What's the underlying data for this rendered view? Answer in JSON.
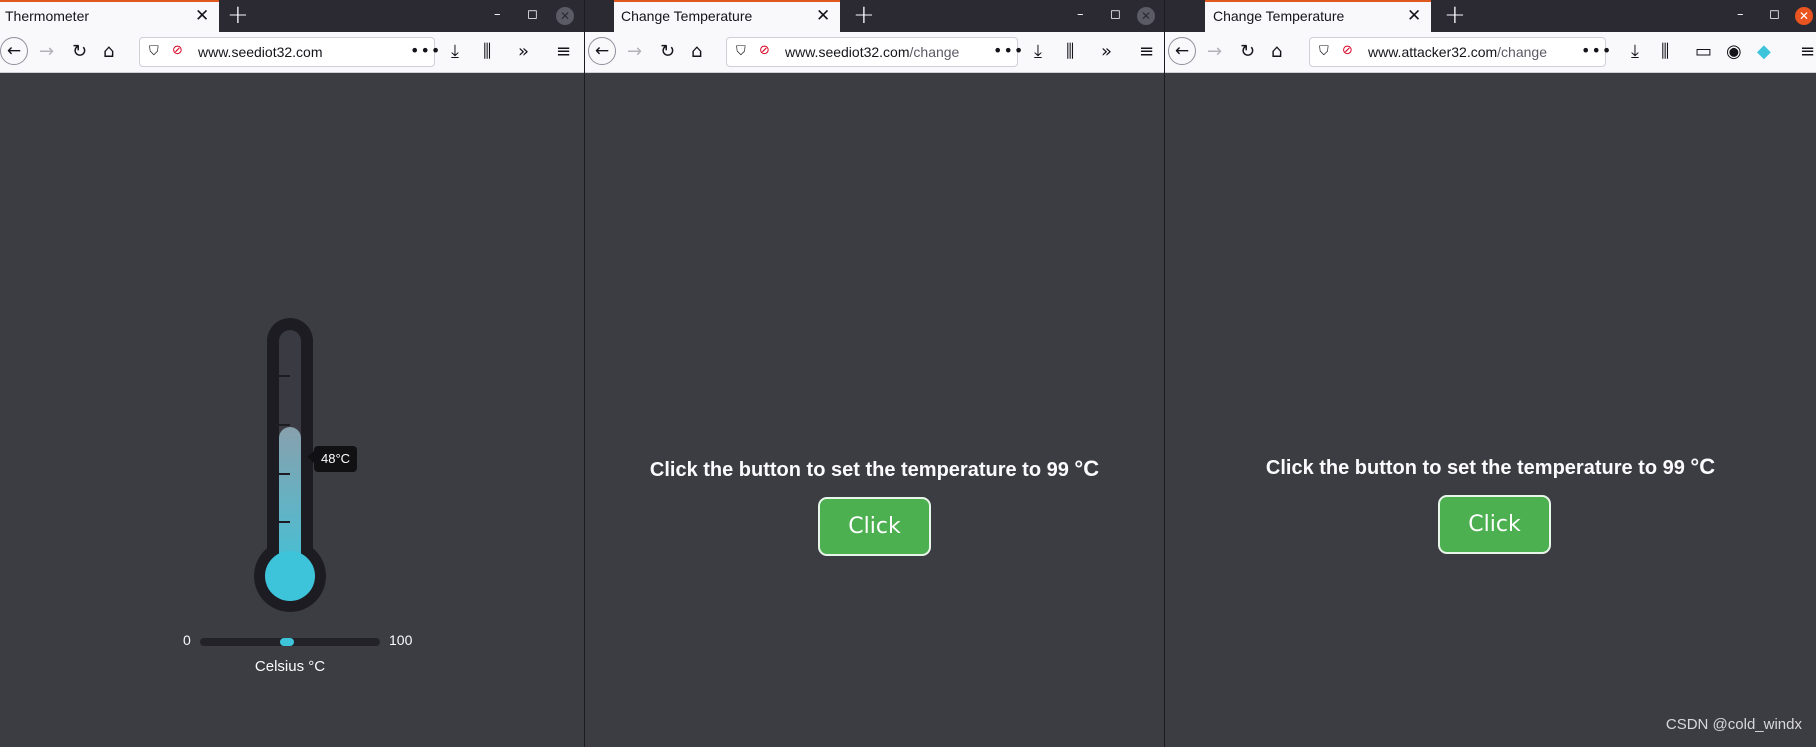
{
  "windows": [
    {
      "tab_title": "Thermometer",
      "url_host": "www.seediot32.com",
      "url_path": "",
      "page": {
        "temperature_label": "48°C",
        "range_min": "0",
        "range_max": "100",
        "unit_label": "Celsius °C",
        "temperature_value": 48
      }
    },
    {
      "tab_title": "Change Temperature",
      "url_host": "www.seediot32.com",
      "url_path": "/change",
      "page": {
        "heading": "Click the button to set the temperature to 99 ",
        "heading_unit": "°C",
        "button_label": "Click"
      }
    },
    {
      "tab_title": "Change Temperature",
      "url_host": "www.attacker32.com",
      "url_path": "/change",
      "page": {
        "heading": "Click the button to set the temperature to 99 ",
        "heading_unit": "°C",
        "button_label": "Click"
      }
    }
  ],
  "chrome": {
    "tab_close_glyph": "✕",
    "new_tab_glyph": "+",
    "minimize_glyph": "–",
    "maximize_glyph": "◻",
    "close_glyph": "✕",
    "more_glyph": "•••",
    "icons": [
      "back-icon",
      "forward-icon",
      "reload-icon",
      "home-icon",
      "tracking-shield-icon",
      "insecure-lock-icon",
      "download-icon",
      "library-icon",
      "overflow-icon",
      "menu-icon",
      "sidebar-icon",
      "account-icon",
      "extension-icon"
    ]
  },
  "colors": {
    "accent": "#e95420",
    "page_bg": "#3c3c43",
    "button_green": "#4caf50",
    "mercury": "#3ec4da"
  },
  "watermark": "CSDN @cold_windx"
}
